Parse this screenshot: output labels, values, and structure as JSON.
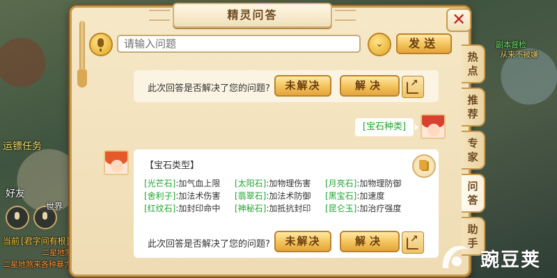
{
  "background": {
    "quest_label": "运镖任务",
    "friend_label": "好友",
    "world_label": "世界",
    "chat_tag": "当前",
    "chat_room": "[君字间有根]",
    "chat_line_1": "二星地煞",
    "chat_line_2": "二星地煞来各种暴力",
    "npc_name": "副本督检",
    "npc_title": "从来不被嫌"
  },
  "dialog": {
    "title": "精灵问答",
    "close_label": "✕"
  },
  "input_bar": {
    "placeholder": "请输入问题",
    "dropdown_glyph": "⌄",
    "send_label": "发送"
  },
  "side_tabs": [
    {
      "label": "热点",
      "active": false
    },
    {
      "label": "推荐",
      "active": false
    },
    {
      "label": "专家",
      "active": false
    },
    {
      "label": "问答",
      "active": true
    },
    {
      "label": "助手",
      "active": false
    }
  ],
  "feedback": {
    "question": "此次回答是否解决了您的问题?",
    "unsolved_label": "未解决",
    "solved_label": "解决"
  },
  "user_message": "[宝石种类]",
  "answer": {
    "title": "【宝石类型】",
    "gems": [
      {
        "name": "[光芒石]",
        "effect": ":加气血上限"
      },
      {
        "name": "[太阳石]",
        "effect": ":加物理伤害"
      },
      {
        "name": "[月亮石]",
        "effect": ":加物理防御"
      },
      {
        "name": "[舍利子]",
        "effect": ":加法术伤害"
      },
      {
        "name": "[翡翠石]",
        "effect": ":加法术防御"
      },
      {
        "name": "[黑宝石]",
        "effect": ":加速度"
      },
      {
        "name": "[红纹石]",
        "effect": ":加封印命中"
      },
      {
        "name": "[神秘石]",
        "effect": ":加抵抗封印"
      },
      {
        "name": "[昆仑玉]",
        "effect": ":加治疗强度"
      }
    ]
  },
  "watermark": "豌豆荚",
  "colors": {
    "gem_name": "#1ea52f",
    "close_x": "#c0231c",
    "panel": "#f6e8c7",
    "button_gold": "#f3c25a"
  }
}
